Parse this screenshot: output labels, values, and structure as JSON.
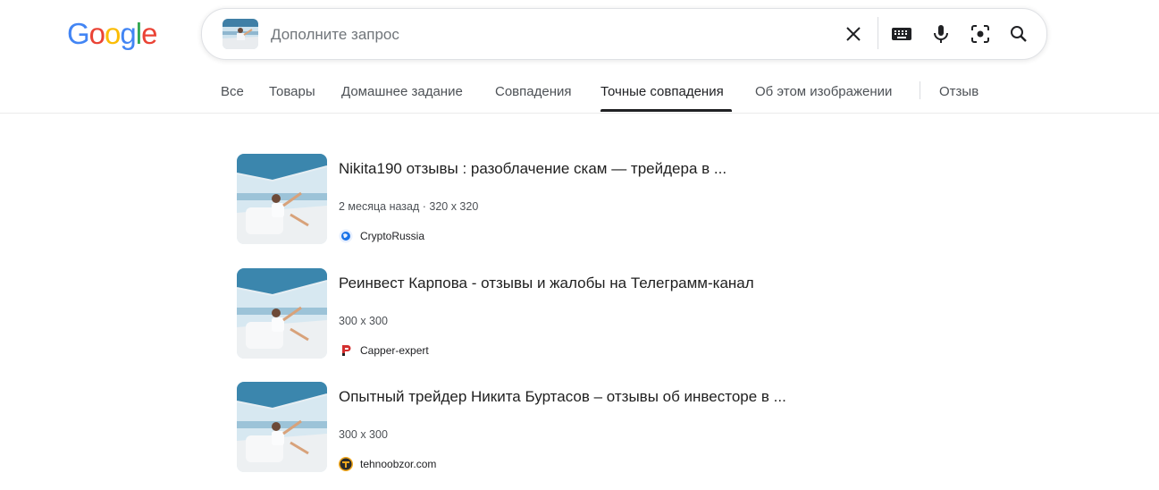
{
  "logo": {
    "letters": [
      "G",
      "o",
      "o",
      "g",
      "l",
      "e"
    ],
    "colors": [
      "#4285F4",
      "#EA4335",
      "#FBBC05",
      "#4285F4",
      "#34A853",
      "#EA4335"
    ]
  },
  "search": {
    "placeholder": "Дополните запрос",
    "value": "",
    "icons": [
      "clear-icon",
      "keyboard-icon",
      "microphone-icon",
      "lens-icon",
      "search-icon"
    ]
  },
  "tabs": [
    {
      "label": "Все"
    },
    {
      "label": "Товары"
    },
    {
      "label": "Домашнее задание"
    },
    {
      "label": "Совпадения"
    },
    {
      "label": "Точные совпадения",
      "active": true
    },
    {
      "label": "Об этом изображении"
    },
    {
      "label": "Отзыв"
    }
  ],
  "results": [
    {
      "title": "Nikita190 отзывы : разоблачение скам — трейдера в ...",
      "meta": "2 месяца назад · 320 x 320",
      "source": "CryptoRussia",
      "favicon": "globe-icon"
    },
    {
      "title": "Реинвест Карпова - отзывы и жалобы на Телеграмм-канал",
      "meta": "300 x 300",
      "source": "Capper-expert",
      "favicon": "capper-expert-icon"
    },
    {
      "title": "Опытный трейдер Никита Буртасов – отзывы об инвесторе в ...",
      "meta": "300 x 300",
      "source": "tehnoobzor.com",
      "favicon": "tehnoobzor-icon"
    }
  ]
}
